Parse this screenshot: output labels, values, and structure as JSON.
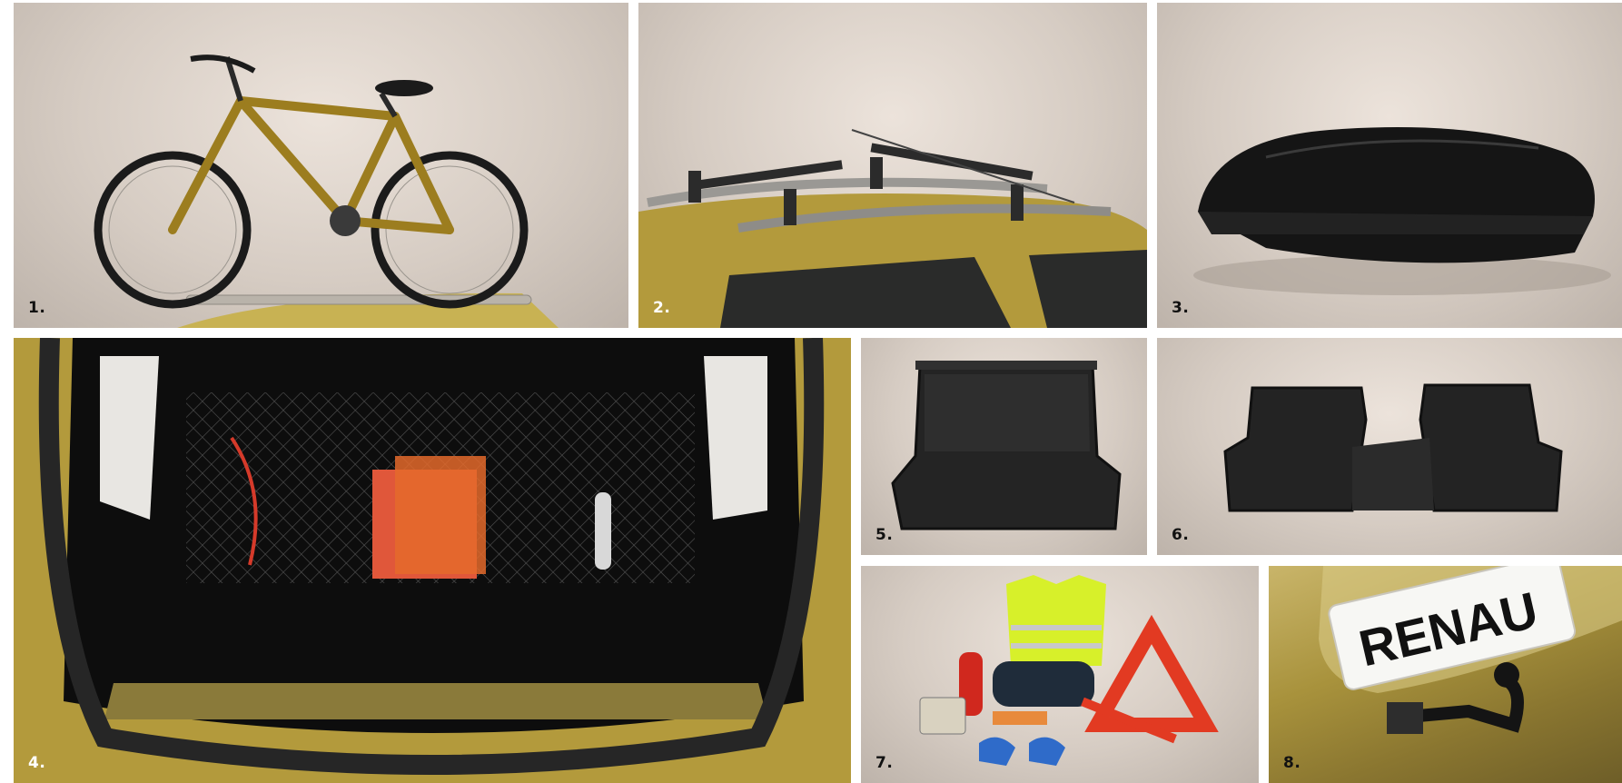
{
  "tiles": [
    {
      "label": "1.",
      "icon": "bicycle-carrier-photo"
    },
    {
      "label": "2.",
      "icon": "roof-bars-photo"
    },
    {
      "label": "3.",
      "icon": "roof-box-photo"
    },
    {
      "label": "4.",
      "icon": "trunk-net-photo"
    },
    {
      "label": "5.",
      "icon": "trunk-mat-photo"
    },
    {
      "label": "6.",
      "icon": "floor-mats-photo"
    },
    {
      "label": "7.",
      "icon": "safety-kit-photo"
    },
    {
      "label": "8.",
      "icon": "tow-bar-photo"
    }
  ],
  "plate_text": "RENAU",
  "colors": {
    "car_body": "#b39a3c",
    "bike_frame": "#9c7d1f",
    "background": "#d6ccc3",
    "number_label": "#111111"
  }
}
